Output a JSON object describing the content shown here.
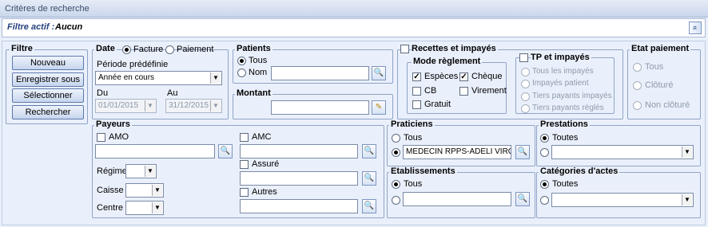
{
  "window": {
    "title": "Critères de recherche"
  },
  "filter": {
    "label": "Filtre actif :",
    "value": "Aucun",
    "collapse_glyph": "»"
  },
  "filtre": {
    "title": "Filtre",
    "buttons": [
      "Nouveau",
      "Enregistrer sous",
      "Sélectionner",
      "Rechercher"
    ]
  },
  "date": {
    "title": "Date",
    "opt_facture": "Facture",
    "opt_paiement": "Paiement",
    "periode_label": "Période prédéfinie",
    "periode_value": "Année en cours",
    "du_label": "Du",
    "au_label": "Au",
    "du_value": "01/01/2015",
    "au_value": "31/12/2015"
  },
  "patients": {
    "title": "Patients",
    "opt_tous": "Tous",
    "opt_nom": "Nom",
    "nom_value": ""
  },
  "montant": {
    "title": "Montant",
    "value": ""
  },
  "recettes": {
    "title": "Recettes et impayés",
    "mode": {
      "title": "Mode règlement",
      "especes": "Espèces",
      "cheque": "Chèque",
      "cb": "CB",
      "virement": "Virement",
      "gratuit": "Gratuit"
    },
    "tp": {
      "title": "TP et impayés",
      "options": [
        "Tous les impayés",
        "Impayés patient",
        "Tiers payants impayés",
        "Tiers payants réglés"
      ]
    }
  },
  "etat": {
    "title": "Etat paiement",
    "options": [
      "Tous",
      "Clôturé",
      "Non clôturé"
    ]
  },
  "payeurs": {
    "title": "Payeurs",
    "amo": "AMO",
    "amc": "AMC",
    "assure": "Assuré",
    "autres": "Autres",
    "regime": "Régime",
    "caisse": "Caisse",
    "centre": "Centre"
  },
  "praticiens": {
    "title": "Praticiens",
    "opt_tous": "Tous",
    "selected": "MEDECIN RPPS-ADELI VIRGINIE"
  },
  "etablissements": {
    "title": "Etablissements",
    "opt_tous": "Tous",
    "value": ""
  },
  "prestations": {
    "title": "Prestations",
    "opt_toutes": "Toutes",
    "value": ""
  },
  "categories": {
    "title": "Catégories d'actes",
    "opt_toutes": "Toutes",
    "value": ""
  },
  "icons": {
    "combo": "▼",
    "lookup": "🔍",
    "eraser": "✎",
    "check": "✓"
  }
}
